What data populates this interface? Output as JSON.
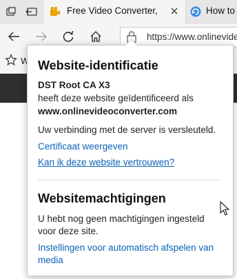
{
  "tabs": [
    {
      "title": "Free Video Converter, C",
      "active": true
    },
    {
      "title": "How to",
      "active": false
    }
  ],
  "address": {
    "url": "https://www.onlinevide"
  },
  "favorites": {
    "peek_text": "W"
  },
  "flyout": {
    "identity_heading": "Website-identificatie",
    "issuer": "DST Root CA X3",
    "identified_line": "heeft deze website geïdentificeerd als",
    "domain": "www.onlinevideoconverter.com",
    "encryption_text": "Uw verbinding met de server is versleuteld.",
    "view_certificate_link": "Certificaat weergeven",
    "trust_link": "Kan ik deze website vertrouwen?",
    "permissions_heading": "Websitemachtigingen",
    "permissions_text": "U hebt nog geen machtigingen ingesteld voor deze site.",
    "autoplay_link": "Instellingen voor automatisch afspelen van media"
  },
  "colors": {
    "link": "#0b62b8",
    "dark_banner": "#2f2f2f"
  }
}
